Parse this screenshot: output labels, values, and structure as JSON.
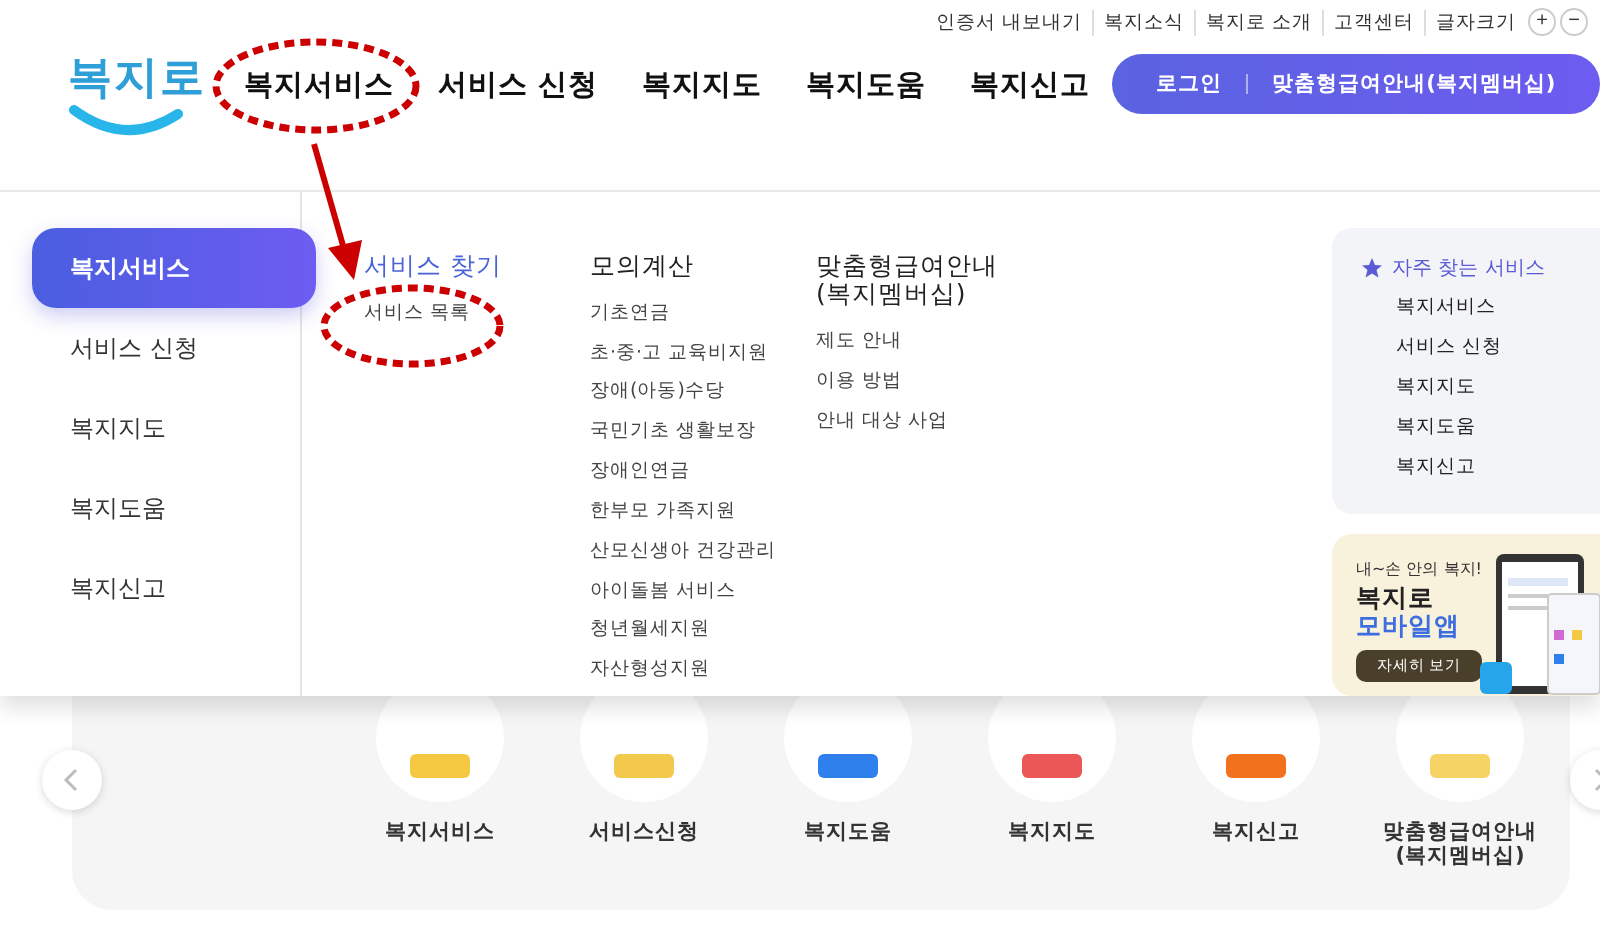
{
  "utility_links": [
    "인증서 내보내기",
    "복지소식",
    "복지로 소개",
    "고객센터"
  ],
  "font_size": {
    "label": "글자크기",
    "increase": "+",
    "decrease": "−"
  },
  "logo": "복지로",
  "nav": [
    "복지서비스",
    "서비스 신청",
    "복지지도",
    "복지도움",
    "복지신고"
  ],
  "header_buttons": [
    "로그인",
    "맞춤형급여안내(복지멤버십)"
  ],
  "sidebar": [
    {
      "label": "복지서비스",
      "selected": true
    },
    {
      "label": "서비스 신청",
      "selected": false
    },
    {
      "label": "복지지도",
      "selected": false
    },
    {
      "label": "복지도움",
      "selected": false
    },
    {
      "label": "복지신고",
      "selected": false
    }
  ],
  "menu_columns": [
    {
      "title": "서비스 찾기",
      "selected": true,
      "items": [
        "서비스 목록"
      ]
    },
    {
      "title": "모의계산",
      "selected": false,
      "items": [
        "기초연금",
        "초·중·고 교육비지원",
        "장애(아동)수당",
        "국민기초 생활보장",
        "장애인연금",
        "한부모 가족지원",
        "산모신생아 건강관리",
        "아이돌봄 서비스",
        "청년월세지원",
        "자산형성지원"
      ]
    },
    {
      "title": "맞춤형급여안내\n(복지멤버십)",
      "selected": false,
      "items": [
        "제도 안내",
        "이용 방법",
        "안내 대상 사업"
      ]
    }
  ],
  "favorites": {
    "title": "자주 찾는 서비스",
    "items": [
      "복지서비스",
      "서비스 신청",
      "복지지도",
      "복지도움",
      "복지신고"
    ]
  },
  "promo": {
    "tagline": "내~손 안의 복지!",
    "title": "복지로",
    "highlight": "모바일앱",
    "button": "자세히 보기"
  },
  "quick_services": [
    {
      "label": "복지서비스",
      "color": "#f5c842"
    },
    {
      "label": "서비스신청",
      "color": "#f2c94c"
    },
    {
      "label": "복지도움",
      "color": "#2f80ed"
    },
    {
      "label": "복지지도",
      "color": "#eb5757"
    },
    {
      "label": "복지신고",
      "color": "#f2711c"
    },
    {
      "label": "맞춤형급여안내\n(복지멤버십)",
      "color": "#f6d365"
    }
  ]
}
